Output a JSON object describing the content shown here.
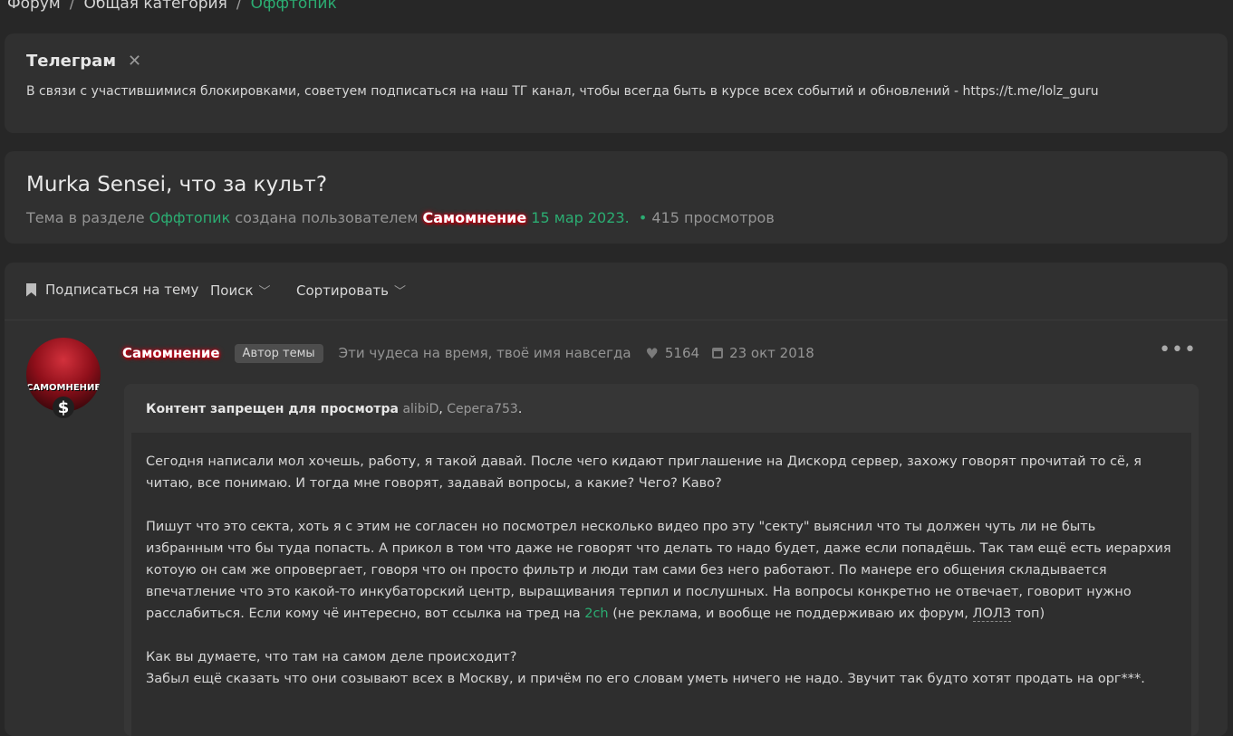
{
  "breadcrumb": {
    "items": [
      "Форум",
      "Общая категория"
    ],
    "current": "Оффтопик",
    "separator": "/"
  },
  "notice": {
    "title": "Телеграм",
    "text": "В связи с участившимися блокировками, советуем подписаться на наш ТГ канал, чтобы всегда быть в курсе всех событий и обновлений - https://t.me/lolz_guru"
  },
  "thread": {
    "title": "Murka Sensei, что за культ?",
    "meta_prefix": "Тема в разделе",
    "section": "Оффтопик",
    "meta_middle": "создана пользователем",
    "author": "Самомнение",
    "date": "15 мар 2023.",
    "views": "415 просмотров"
  },
  "toolbar": {
    "subscribe": "Подписаться на тему",
    "search": "Поиск",
    "sort": "Сортировать"
  },
  "post": {
    "avatar_text": "САМОМНЕНИЕ",
    "author": "Самомнение",
    "badge": "Автор темы",
    "status": "Эти чудеса на время, твоё имя навсегда",
    "likes": "5164",
    "joined": "23 окт 2018",
    "restrict_label": "Контент запрещен для просмотра",
    "restrict_user1": "alibiD",
    "restrict_user2": "Серега753",
    "p1": "Сегодня написали мол хочешь, работу, я такой давай. После чего кидают приглашение на Дискорд сервер, захожу говорят прочитай то сё, я читаю, все понимаю. И тогда мне говорят, задавай вопросы, а какие? Чего? Каво?",
    "p2a": "Пишут что это секта, хоть я с этим не согласен но посмотрел несколько видео про эту \"секту\" выяснил что ты должен чуть ли не быть избранным что бы туда попасть. А прикол в том что даже не говорят что делать то надо будет, даже если попадёшь. Так там ещё есть иерархия котоую он сам же опровергает, говоря что он просто фильтр и люди там сами без него работают. По манере его общения складывается впечатление что это какой-то инкубаторский центр, выращивания терпил и послушных. На вопросы конкретно не отвечает, говорит нужно расслабиться. Если кому чё интересно, вот ссылка на тред на",
    "p2_link": "2ch",
    "p2b": "(не реклама, и вообще не поддерживаю их форум,",
    "p2_abbr": "ЛОЛЗ",
    "p2c": "топ)",
    "p3a": "Как вы думаете, что там на самом деле происходит?",
    "p3b": "Забыл ещё сказать что они созывают всех в Москву, и причём по его словам уметь ничего не надо. Звучит так будто хотят продать на орг***."
  },
  "colors": {
    "background": "#272727",
    "card": "#303030",
    "accent": "#2bad72",
    "nick_glow": "#d0021b"
  }
}
